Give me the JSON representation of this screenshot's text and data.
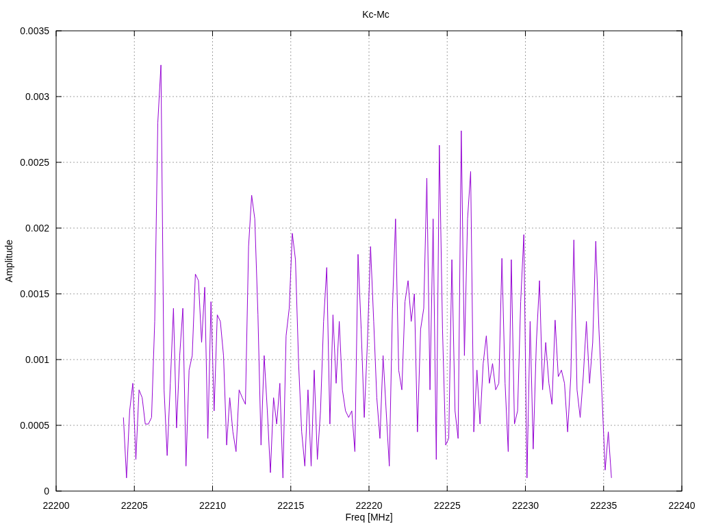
{
  "chart_data": {
    "type": "line",
    "title": "Kc-Mc",
    "xlabel": "Freq [MHz]",
    "ylabel": "Amplitude",
    "x": [
      22204.3,
      22204.5,
      22204.7,
      22204.9,
      22205.1,
      22205.3,
      22205.5,
      22205.7,
      22205.9,
      22206.1,
      22206.3,
      22206.5,
      22206.7,
      22206.9,
      22207.1,
      22207.3,
      22207.5,
      22207.7,
      22207.9,
      22208.1,
      22208.3,
      22208.5,
      22208.7,
      22208.9,
      22209.1,
      22209.3,
      22209.5,
      22209.7,
      22209.9,
      22210.1,
      22210.3,
      22210.5,
      22210.7,
      22210.9,
      22211.1,
      22211.3,
      22211.5,
      22211.7,
      22211.9,
      22212.1,
      22212.3,
      22212.5,
      22212.7,
      22212.9,
      22213.1,
      22213.3,
      22213.5,
      22213.7,
      22213.9,
      22214.1,
      22214.3,
      22214.5,
      22214.7,
      22214.9,
      22215.1,
      22215.3,
      22215.5,
      22215.7,
      22215.9,
      22216.1,
      22216.3,
      22216.5,
      22216.7,
      22216.9,
      22217.1,
      22217.3,
      22217.5,
      22217.7,
      22217.9,
      22218.1,
      22218.3,
      22218.5,
      22218.7,
      22218.9,
      22219.1,
      22219.3,
      22219.5,
      22219.7,
      22219.9,
      22220.1,
      22220.3,
      22220.5,
      22220.7,
      22220.9,
      22221.1,
      22221.3,
      22221.5,
      22221.7,
      22221.9,
      22222.1,
      22222.3,
      22222.5,
      22222.7,
      22222.9,
      22223.1,
      22223.3,
      22223.5,
      22223.7,
      22223.9,
      22224.1,
      22224.3,
      22224.5,
      22224.7,
      22224.9,
      22225.1,
      22225.3,
      22225.5,
      22225.7,
      22225.9,
      22226.1,
      22226.3,
      22226.5,
      22226.7,
      22226.9,
      22227.1,
      22227.3,
      22227.5,
      22227.7,
      22227.9,
      22228.1,
      22228.3,
      22228.5,
      22228.7,
      22228.9,
      22229.1,
      22229.3,
      22229.5,
      22229.7,
      22229.9,
      22230.1,
      22230.3,
      22230.5,
      22230.7,
      22230.9,
      22231.1,
      22231.3,
      22231.5,
      22231.7,
      22231.9,
      22232.1,
      22232.3,
      22232.5,
      22232.7,
      22232.9,
      22233.1,
      22233.3,
      22233.5,
      22233.7,
      22233.9,
      22234.1,
      22234.3,
      22234.5,
      22234.7,
      22234.9,
      22235.1,
      22235.3,
      22235.5
    ],
    "series": [
      {
        "color": "#9400d3",
        "values": [
          0.00056,
          0.0001,
          0.00061,
          0.00082,
          0.00024,
          0.00077,
          0.00071,
          0.00051,
          0.00051,
          0.00056,
          0.00129,
          0.0028,
          0.00324,
          0.00077,
          0.00027,
          0.00082,
          0.00139,
          0.00048,
          0.00103,
          0.00139,
          0.00019,
          0.00092,
          0.00103,
          0.00165,
          0.0016,
          0.00113,
          0.00155,
          0.0004,
          0.00144,
          0.00061,
          0.00134,
          0.00129,
          0.00103,
          0.00035,
          0.00071,
          0.00045,
          0.0003,
          0.00077,
          0.00071,
          0.00066,
          0.00186,
          0.00225,
          0.00207,
          0.00134,
          0.00035,
          0.00103,
          0.00061,
          0.00014,
          0.00071,
          0.00051,
          0.00082,
          0.0001,
          0.00118,
          0.00139,
          0.00196,
          0.00176,
          0.00097,
          0.00045,
          0.00019,
          0.00077,
          0.00019,
          0.00092,
          0.00024,
          0.00061,
          0.00129,
          0.0017,
          0.00051,
          0.00134,
          0.00082,
          0.00129,
          0.00077,
          0.00061,
          0.00056,
          0.00061,
          0.0003,
          0.0018,
          0.00123,
          0.00056,
          0.00113,
          0.00186,
          0.00129,
          0.00071,
          0.0004,
          0.00103,
          0.00061,
          0.00019,
          0.00139,
          0.00207,
          0.00092,
          0.00077,
          0.00144,
          0.0016,
          0.00129,
          0.0015,
          0.00045,
          0.00123,
          0.00139,
          0.00238,
          0.00077,
          0.00207,
          0.00024,
          0.00263,
          0.00123,
          0.00035,
          0.0004,
          0.00176,
          0.00061,
          0.0004,
          0.00274,
          0.00103,
          0.00207,
          0.00243,
          0.00045,
          0.00092,
          0.00051,
          0.00097,
          0.00118,
          0.00082,
          0.00097,
          0.00077,
          0.00082,
          0.00177,
          0.00082,
          0.0003,
          0.00176,
          0.00051,
          0.00061,
          0.00144,
          0.00195,
          0.0001,
          0.00129,
          0.00032,
          0.00113,
          0.0016,
          0.00077,
          0.00113,
          0.00082,
          0.00066,
          0.0013,
          0.00087,
          0.00092,
          0.00082,
          0.00045,
          0.00087,
          0.00191,
          0.00077,
          0.00056,
          0.00087,
          0.00129,
          0.00082,
          0.00113,
          0.0019,
          0.00123,
          0.00071,
          0.00016,
          0.00045,
          0.0001
        ]
      }
    ],
    "grid": true,
    "xlim": [
      22200,
      22240
    ],
    "ylim": [
      0,
      0.0035
    ],
    "xticks": [
      22200,
      22205,
      22210,
      22215,
      22220,
      22225,
      22230,
      22235,
      22240
    ],
    "yticks": [
      0,
      0.0005,
      0.001,
      0.0015,
      0.002,
      0.0025,
      0.003,
      0.0035
    ]
  }
}
